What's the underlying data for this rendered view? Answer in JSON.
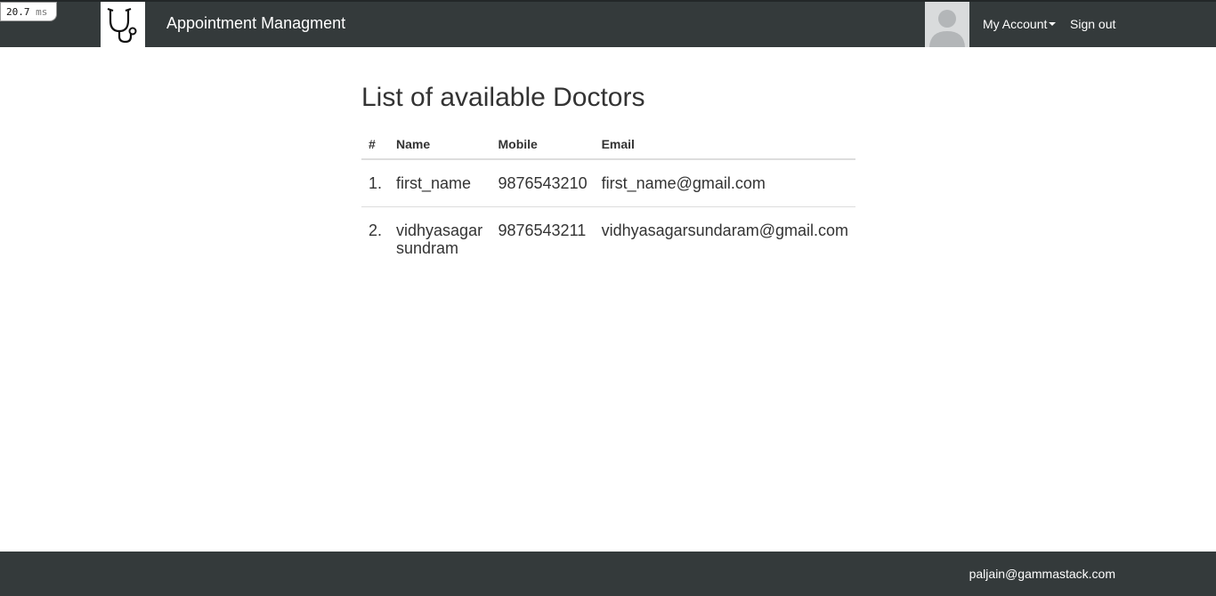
{
  "perf": {
    "value": "20.7",
    "unit": "ms"
  },
  "navbar": {
    "logo_icon": "stethoscope-icon",
    "brand": "Appointment Managment",
    "avatar_icon": "user-avatar-icon",
    "my_account": "My Account",
    "sign_out": "Sign out"
  },
  "main": {
    "title": "List of available Doctors",
    "columns": [
      "#",
      "Name",
      "Mobile",
      "Email"
    ],
    "rows": [
      {
        "index": "1.",
        "name": "first_name",
        "mobile": "9876543210",
        "email": "first_name@gmail.com"
      },
      {
        "index": "2.",
        "name": "vidhyasagar sundram",
        "mobile": "9876543211",
        "email": "vidhyasagarsundaram@gmail.com"
      }
    ]
  },
  "footer": {
    "email": "paljain@gammastack.com"
  }
}
